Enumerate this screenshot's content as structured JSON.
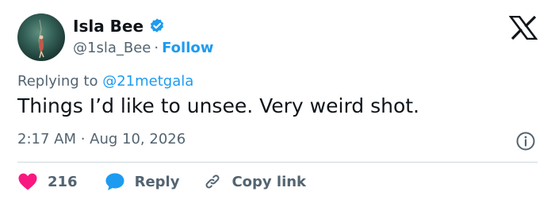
{
  "author": {
    "display_name": "Isla Bee",
    "handle": "@1sla_Bee",
    "separator": "·",
    "follow_label": "Follow"
  },
  "tweet": {
    "replying_prefix": "Replying to",
    "replying_to": "@21metgala",
    "text": "Things I’d like to unsee. Very weird shot.",
    "timestamp": "2:17 AM · Aug 10, 2026"
  },
  "actions": {
    "likes_count": "216",
    "reply_label": "Reply",
    "copy_link_label": "Copy link"
  },
  "icons": {
    "verified": "verified-badge-icon",
    "x_logo": "x-logo-icon",
    "info": "info-icon",
    "heart": "heart-icon",
    "reply": "reply-bubble-icon",
    "link": "link-icon"
  },
  "colors": {
    "accent": "#1d9bf0",
    "heart": "#f91880",
    "text": "#0f1419",
    "muted": "#536471"
  }
}
